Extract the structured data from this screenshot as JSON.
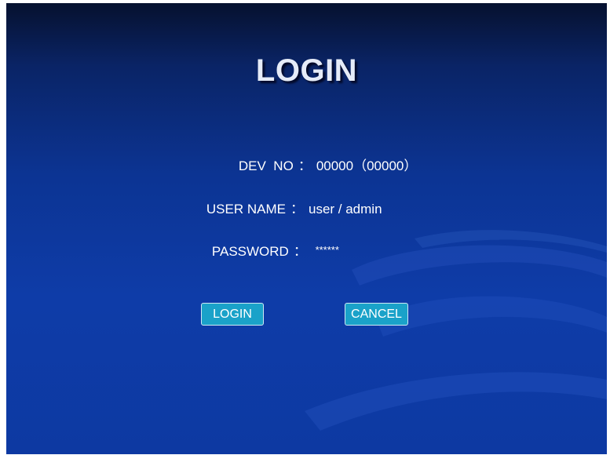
{
  "login_screen": {
    "title": "LOGIN",
    "fields": {
      "dev_no": {
        "label": "DEV  NO",
        "separator": "：",
        "value": "00000（00000）"
      },
      "user_name": {
        "label": "USER NAME",
        "separator": "：",
        "value": "user / admin"
      },
      "password": {
        "label": "PASSWORD",
        "separator": "：",
        "value": "******"
      }
    },
    "buttons": {
      "login_label": "LOGIN",
      "cancel_label": "CANCEL"
    }
  },
  "colors": {
    "background_top": "#06112f",
    "background_main": "#0e3ca8",
    "button_fill": "#1aa2c9",
    "button_border": "#cfe9f4",
    "text": "#ffffff"
  }
}
